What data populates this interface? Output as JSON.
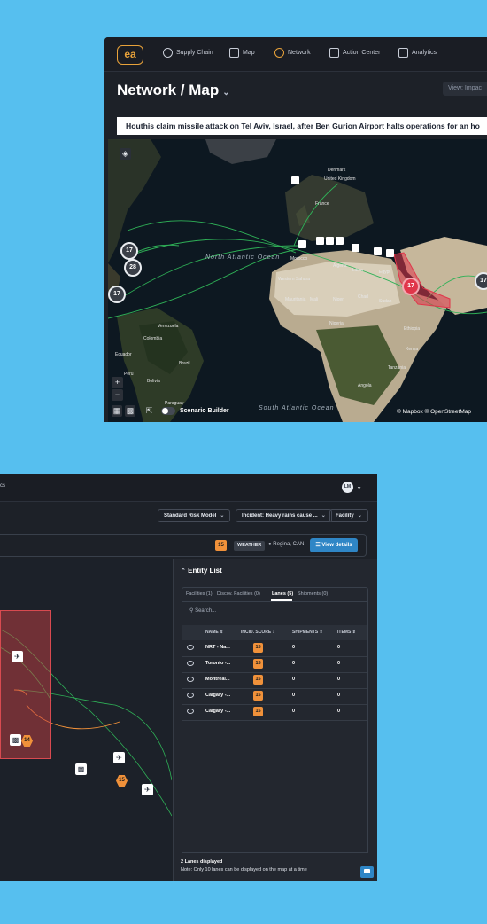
{
  "top_window": {
    "logo": "ea",
    "nav": [
      {
        "label": "Supply Chain",
        "icon": "supply-chain-icon"
      },
      {
        "label": "Map",
        "icon": "map-icon"
      },
      {
        "label": "Network",
        "icon": "network-icon"
      },
      {
        "label": "Action Center",
        "icon": "action-center-icon"
      },
      {
        "label": "Analytics",
        "icon": "analytics-icon"
      }
    ],
    "page_title": "Network / Map",
    "view_select": "View: Impac",
    "alert_banner": "Houthis claim missile attack on Tel Aviv, Israel, after Ben Gurion Airport halts operations for an ho",
    "map": {
      "zoom_in": "+",
      "zoom_out": "−",
      "clusters": [
        "17",
        "28",
        "17",
        "17",
        "17"
      ],
      "ocean_labels": [
        "North Atlantic Ocean",
        "South Atlantic Ocean"
      ],
      "place_labels": [
        "Denmark",
        "United Kingdom",
        "France",
        "Algeria",
        "Libya",
        "Egypt",
        "Morocco",
        "Western Sahara",
        "Mauritania",
        "Mali",
        "Niger",
        "Chad",
        "Sudan",
        "Nigeria",
        "Ethiopia",
        "Kenya",
        "Tanzania",
        "Angola",
        "Colombia",
        "Ecuador",
        "Peru",
        "Brazil",
        "Bolivia",
        "Paraguay",
        "Venezuela",
        "Algeria"
      ],
      "scenario_builder": "Scenario Builder",
      "attribution": "© Mapbox  © OpenStreetMap"
    }
  },
  "bottom_window": {
    "nav_cut": "cs",
    "avatar": "LM",
    "risk_model": "Standard Risk Model",
    "incident": "Incident: Heavy rains cause ...",
    "facility": "Facility",
    "info_score": "15",
    "weather": "WEATHER",
    "location": "Regina, CAN",
    "view_details": "View details",
    "map_badges": [
      "14",
      "15"
    ],
    "entity_list": {
      "title": "Entity List",
      "tabs": [
        "Facilities (1)",
        "Discov. Facilities (0)",
        "Lanes (5)",
        "Shipments (0)"
      ],
      "active_tab": "Lanes (5)",
      "search_placeholder": "Search...",
      "columns": [
        "NAME",
        "INCID. SCORE",
        "SHIPMENTS",
        "ITEMS"
      ],
      "rows": [
        {
          "name": "NRT - Na...",
          "score": "15",
          "shipments": "0",
          "items": "0"
        },
        {
          "name": "Toronto -...",
          "score": "15",
          "shipments": "0",
          "items": "0"
        },
        {
          "name": "Montreal...",
          "score": "15",
          "shipments": "0",
          "items": "0"
        },
        {
          "name": "Calgary -...",
          "score": "15",
          "shipments": "0",
          "items": "0"
        },
        {
          "name": "Calgary -...",
          "score": "15",
          "shipments": "0",
          "items": "0"
        }
      ],
      "footer_line1": "2 Lanes displayed",
      "footer_line2": "Note: Only 10 lanes can be displayed on the map at a time"
    }
  },
  "colors": {
    "background": "#56bfef",
    "accent_orange": "#f0913a",
    "alert_red": "#e0364a",
    "route_green": "#2fb157",
    "button_blue": "#2f86c6"
  }
}
